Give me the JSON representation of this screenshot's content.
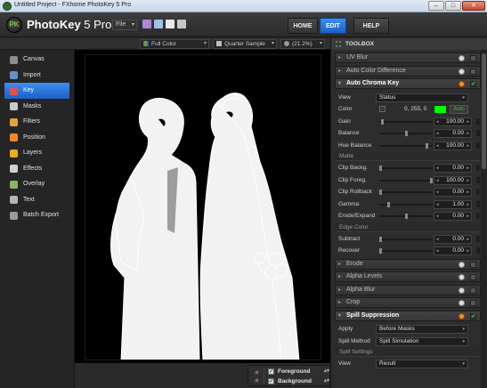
{
  "window": {
    "title": "Untitled Project - FXhome PhotoKey 5 Pro",
    "controls": {
      "minimize": "–",
      "maximize": "□",
      "close": "✕"
    }
  },
  "header": {
    "logo_mark": "PK",
    "logo_name": "PhotoKey",
    "logo_version": " 5 Pro",
    "file_menu": "File",
    "nav": {
      "home": "HOME",
      "edit": "EDIT",
      "help": "HELP"
    }
  },
  "subtoolbar": {
    "color_mode": "Full Color",
    "sample_mode": "Quarter Sample",
    "zoom": "(21.2%)"
  },
  "sidebar": {
    "items": [
      {
        "label": "Canvas",
        "icon": "canvas-icon",
        "color": "#8e8e8e"
      },
      {
        "label": "Import",
        "icon": "import-icon",
        "color": "#6a8fc8"
      },
      {
        "label": "Key",
        "icon": "key-icon",
        "color": "#e05050",
        "active": true
      },
      {
        "label": "Masks",
        "icon": "masks-icon",
        "color": "#c9c9c9"
      },
      {
        "label": "Filters",
        "icon": "filters-icon",
        "color": "#e6a23c"
      },
      {
        "label": "Position",
        "icon": "position-icon",
        "color": "#f08a24"
      },
      {
        "label": "Layers",
        "icon": "layers-icon",
        "color": "#e4b020"
      },
      {
        "label": "Effects",
        "icon": "effects-icon",
        "color": "#d0d0d0"
      },
      {
        "label": "Overlay",
        "icon": "overlay-icon",
        "color": "#8ab36a"
      },
      {
        "label": "Text",
        "icon": "text-icon",
        "color": "#b5b5b5"
      },
      {
        "label": "Batch Export",
        "icon": "batch-export-icon",
        "color": "#9a9a9a"
      }
    ]
  },
  "layers": {
    "items": [
      {
        "label": "Foreground",
        "checked": true
      },
      {
        "label": "Background",
        "checked": true
      }
    ],
    "star": "★",
    "checkmark": "✓"
  },
  "toolbox": {
    "title": "TOOLBOX",
    "effects_top": [
      "UV Blur",
      "Auto Color Difference"
    ],
    "auto_chroma": {
      "title": "Auto Chroma Key",
      "view_label": "View",
      "view_value": "Status",
      "color_label": "Color",
      "color_value": "0, 255, 0",
      "color_hex": "#00ff00",
      "auto_label": "Auto",
      "rows": [
        {
          "label": "Gain",
          "value": "100.00",
          "level": 0.04
        },
        {
          "label": "Balance",
          "value": "0.00",
          "level": 0.5
        },
        {
          "label": "Hue Balance",
          "value": "100.00",
          "level": 0.92
        }
      ],
      "matte_title": "Matte",
      "matte_rows": [
        {
          "label": "Clip Backg.",
          "value": "0.00",
          "level": 0.0
        },
        {
          "label": "Clip Foreg.",
          "value": "100.00",
          "level": 1.0
        },
        {
          "label": "Clip Rollback",
          "value": "0.00",
          "level": 0.0
        },
        {
          "label": "Gamma",
          "value": "1.00",
          "level": 0.15
        },
        {
          "label": "Erode/Expand",
          "value": "0.00",
          "level": 0.5
        }
      ],
      "edge_title": "Edge Color",
      "edge_rows": [
        {
          "label": "Subtract",
          "value": "0.00",
          "level": 0.0
        },
        {
          "label": "Recover",
          "value": "0.00",
          "level": 0.0
        }
      ]
    },
    "effects_mid": [
      "Erode",
      "Alpha Levels",
      "Alpha Blur",
      "Crop"
    ],
    "spill": {
      "title": "Spill Suppression",
      "apply_label": "Apply",
      "apply_value": "Before Masks",
      "method_label": "Spill Method",
      "method_value": "Spill Simulation",
      "settings_title": "Spill Settings",
      "view_label": "View",
      "view_value": "Result"
    }
  }
}
